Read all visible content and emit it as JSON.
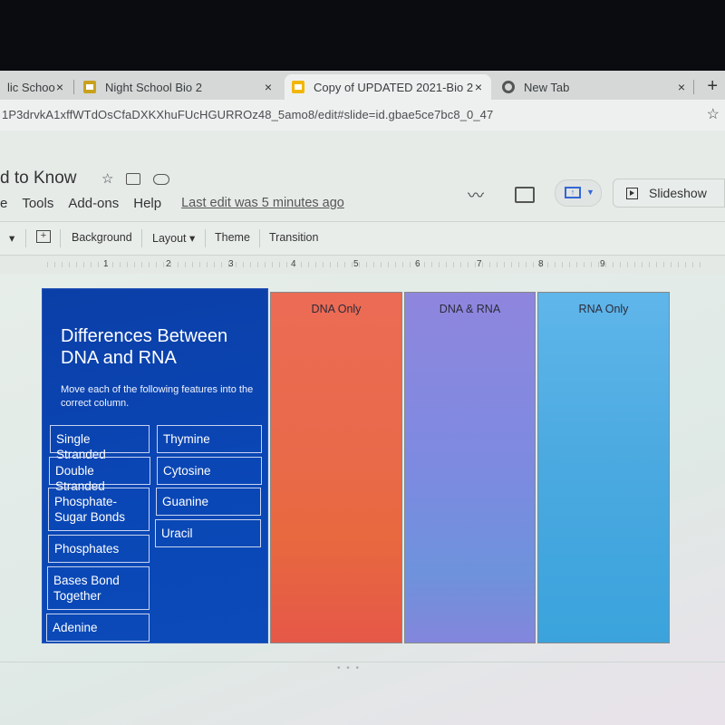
{
  "browser": {
    "tabs": [
      {
        "label": "lic Schoo",
        "icon": "partial-tab"
      },
      {
        "label": "Night School Bio 2",
        "icon": "google-classroom-icon"
      },
      {
        "label": "Copy of UPDATED 2021-Bio 2",
        "icon": "google-slides-icon",
        "active": true
      },
      {
        "label": "New Tab",
        "icon": "chrome-icon"
      }
    ],
    "close_glyph": "×",
    "new_tab_glyph": "+",
    "url": "1P3drvkA1xffWTdOsCfaDXKXhuFUcHGURROz48_5amo8/edit#slide=id.gbae5ce7bc8_0_47",
    "bookmark_glyph": "☆"
  },
  "docs": {
    "title": "d to Know",
    "title_icons": {
      "star": "☆"
    },
    "menu": [
      "e",
      "Tools",
      "Add-ons",
      "Help"
    ],
    "last_edit": "Last edit was 5 minutes ago",
    "right": {
      "trend_glyph": "〰",
      "slideshow_label": "Slideshow"
    }
  },
  "toolbar": {
    "add_comment_glyph": "+",
    "background": "Background",
    "layout": "Layout ▾",
    "theme": "Theme",
    "transition": "Transition"
  },
  "ruler": [
    "1",
    "2",
    "3",
    "4",
    "5",
    "6",
    "7",
    "8",
    "9"
  ],
  "slide": {
    "title": "Differences Between DNA and RNA",
    "instructions": "Move each of the following features into the correct column.",
    "features_left": [
      "Single Stranded",
      "Double Stranded",
      "Phosphate- Sugar Bonds",
      "Phosphates",
      "Bases Bond Together",
      "Adenine"
    ],
    "features_right": [
      "Thymine",
      "Cytosine",
      "Guanine",
      "Uracil"
    ],
    "columns": [
      {
        "label": "DNA Only",
        "color": "#e86a4a"
      },
      {
        "label": "DNA & RNA",
        "color": "#7d8ae0"
      },
      {
        "label": "RNA Only",
        "color": "#4aa9e0"
      }
    ],
    "panel_color": "#0a47b6"
  },
  "filmstrip_handle": "• • •"
}
